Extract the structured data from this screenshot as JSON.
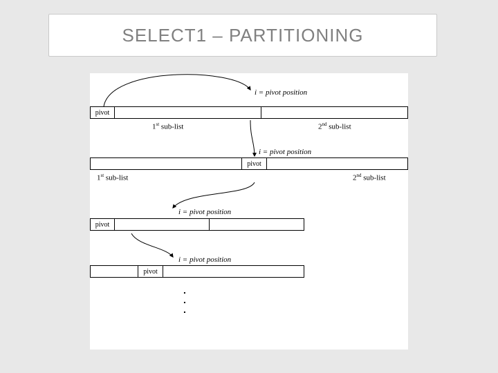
{
  "title": "SELECT1 – PARTITIONING",
  "labels": {
    "pivot": "pivot",
    "i_eq_pivot": "i = pivot position",
    "first_sublist": "1",
    "first_sublist_sup": "st",
    "first_sublist_tail": " sub-list",
    "second_sublist": "2",
    "second_sublist_sup": "nd",
    "second_sublist_tail": " sub-list"
  }
}
